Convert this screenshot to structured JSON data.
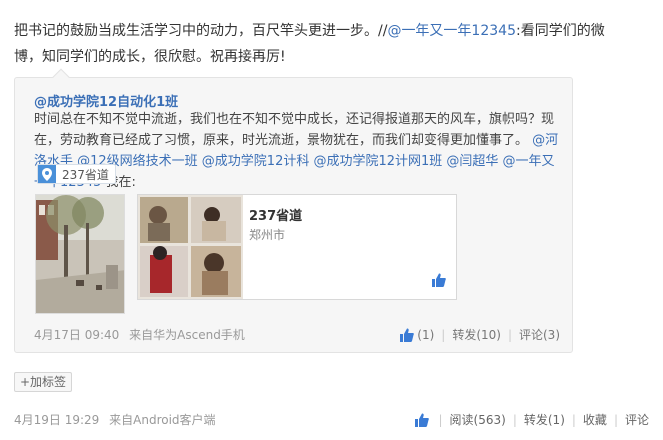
{
  "post": {
    "text_1": "把书记的鼓励当成生活学习中的动力，百尺竿头更进一步。//",
    "mention_1": "@一年又一年12345",
    "text_2": ":看同学们的微博，知同学们的成长，很欣慰。祝再接再厉!"
  },
  "quote": {
    "author": "@成功学院12自动化1班",
    "text_1": "时间总在不知不觉中流逝，我们也在不知不觉中成长，还记得报道那天的风车，旗帜吗？现在，劳动教育已经成了习惯，原来，时光流逝，景物犹在，而我们却变得更加懂事了。",
    "mentions": "@河洛水手 @12级网络技术一班 @成功学院12计科 @成功学院12计网1班 @闫超华 @一年又一年12345",
    "text_2": " 我在:",
    "location_tag": "237省道",
    "place_name": "237省道",
    "place_city": "郑州市",
    "time": "4月17日 09:40",
    "source": "来自华为Ascend手机",
    "like_count": "(1)",
    "repost": "转发(10)",
    "comment": "评论(3)"
  },
  "tags": {
    "add_label": "+加标签"
  },
  "footer": {
    "time": "4月19日 19:29",
    "source": "来自Android客户端",
    "read": "阅读(563)",
    "repost": "转发(1)",
    "favorite": "收藏",
    "comment": "评论"
  },
  "colors": {
    "link": "#3b6fb6",
    "pin": "#4a90d9",
    "like": "#3a7bd5"
  }
}
